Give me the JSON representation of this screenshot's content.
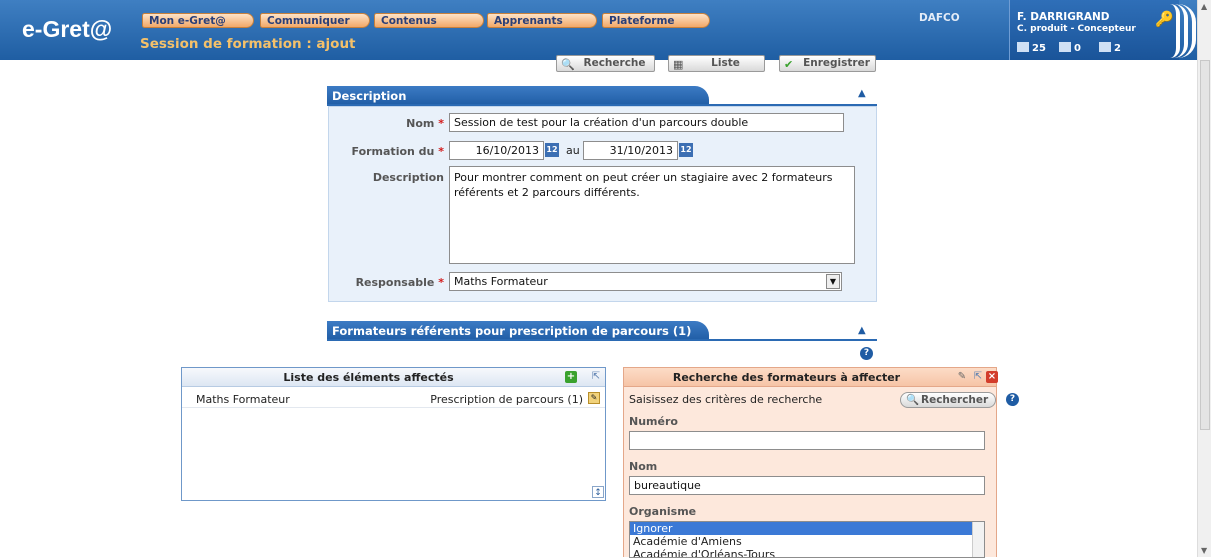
{
  "header": {
    "logo": "e-Gret@",
    "menu": [
      "Mon e-Gret@",
      "Communiquer",
      "Contenus",
      "Apprenants",
      "Plateforme"
    ],
    "page_title": "Session de formation : ajout",
    "org": "DAFCO",
    "user_name": "F. DARRIGRAND",
    "user_role": "C. produit - Concepteur",
    "counters": {
      "users": "25",
      "mail": "0",
      "chat": "2"
    }
  },
  "toolbar": {
    "search_label": "Recherche",
    "list_label": "Liste",
    "save_label": "Enregistrer"
  },
  "description": {
    "section_title": "Description",
    "name_label": "Nom",
    "name_value": "Session de test pour la création d'un parcours double",
    "date_label": "Formation du",
    "date_from": "16/10/2013",
    "date_sep": "au",
    "date_to": "31/10/2013",
    "calendar_glyph": "12",
    "desc_label": "Description",
    "desc_value": "Pour montrer comment on peut créer un stagiaire avec 2 formateurs référents et 2 parcours différents.",
    "resp_label": "Responsable",
    "resp_value": "Maths Formateur"
  },
  "trainers": {
    "section_title": "Formateurs référents pour prescription de parcours (1)"
  },
  "assigned": {
    "title": "Liste des éléments affectés",
    "items": [
      {
        "name": "Maths Formateur",
        "action": "Prescription de parcours (1)"
      }
    ]
  },
  "search": {
    "title": "Recherche des formateurs à affecter",
    "hint": "Saisissez des critères de recherche",
    "button": "Rechercher",
    "numero_label": "Numéro",
    "numero_value": "",
    "nom_label": "Nom",
    "nom_value": "bureautique",
    "org_label": "Organisme",
    "org_options": [
      "Ignorer",
      "Académie d'Amiens",
      "Académie d'Orléans-Tours"
    ],
    "org_selected": "Ignorer"
  }
}
